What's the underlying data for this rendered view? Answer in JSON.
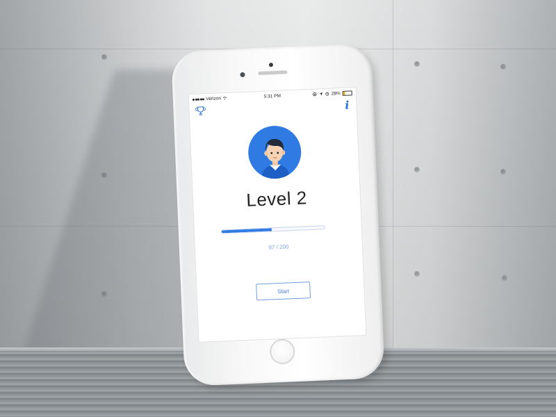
{
  "status_bar": {
    "carrier": "Verizon",
    "time": "5:31 PM",
    "battery_percent": "28%",
    "signal_icon": "signal-dots-icon",
    "wifi_icon": "wifi-icon",
    "battery_level": 0.28,
    "battery_color": "#e0b631"
  },
  "header": {
    "trophy_icon": "trophy-icon",
    "info_label": "i"
  },
  "profile": {
    "avatar_icon": "avatar-icon",
    "avatar_bg": "#2f7be3"
  },
  "level": {
    "title": "Level 2",
    "progress_current": 97,
    "progress_max": 200,
    "progress_text": "97 / 200",
    "progress_fraction": 0.485,
    "accent": "#2f7be3"
  },
  "actions": {
    "start_label": "Start"
  }
}
